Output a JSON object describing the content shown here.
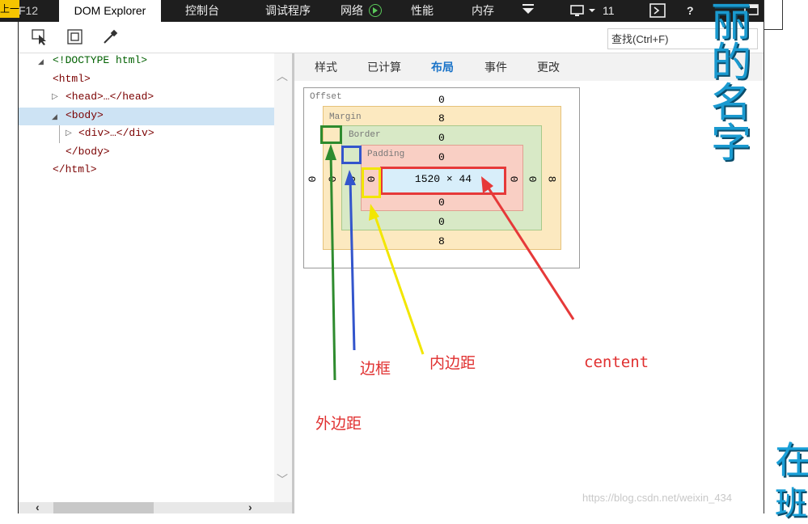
{
  "topbar": {
    "f12_label": "F12",
    "corner_text": "上一",
    "tabs": [
      "DOM Explorer",
      "控制台",
      "调试程序",
      "网络",
      "性能",
      "内存"
    ],
    "count": "11",
    "help": "?"
  },
  "toolbar": {
    "search_placeholder": "查找(Ctrl+F)"
  },
  "dom_tree": {
    "doctype": "<!DOCTYPE html>",
    "html_open": "<html>",
    "head": "<head>…</head>",
    "body_open": "<body>",
    "div": "<div>…</div>",
    "body_close": "</body>",
    "html_close": "</html>"
  },
  "subtabs": [
    "样式",
    "已计算",
    "布局",
    "事件",
    "更改"
  ],
  "active_subtab": "布局",
  "box_model": {
    "offset_label": "Offset",
    "margin_label": "Margin",
    "border_label": "Border",
    "padding_label": "Padding",
    "offset_top": "0",
    "offset_left": "0",
    "offset_right": "0",
    "offset_bottom": "",
    "margin_top": "8",
    "margin_left": "0",
    "margin_right": "8",
    "margin_bottom": "8",
    "border_top": "0",
    "border_left": "0",
    "border_right": "0",
    "border_bottom": "0",
    "padding_top": "0",
    "padding_left": "0",
    "padding_right": "0",
    "padding_bottom": "0",
    "content_size": "1520 × 44"
  },
  "annotations": {
    "margin": "外边距",
    "border": "边框",
    "padding": "内边距",
    "content": "centent"
  },
  "colors": {
    "margin_arrow": "#2e8b2e",
    "border_arrow": "#3355cc",
    "padding_arrow": "#f2e600",
    "content_arrow": "#e63939",
    "active_tab": "#1a73c8"
  },
  "side_text": {
    "vertical": "丽的名字",
    "bottom": "在",
    "bottom2": "班"
  },
  "watermark": "https://blog.csdn.net/weixin_434"
}
